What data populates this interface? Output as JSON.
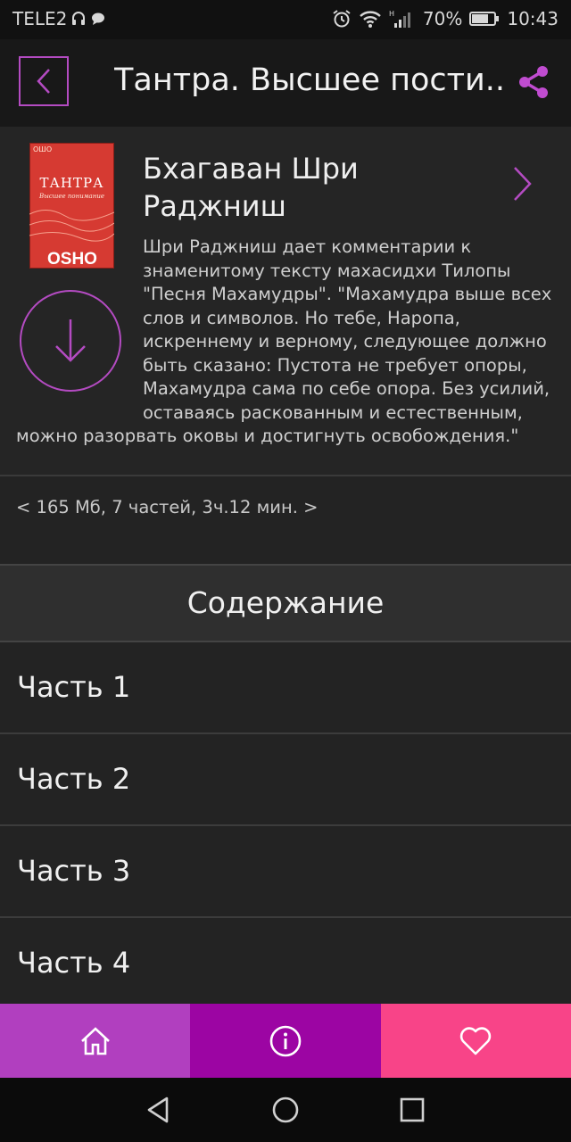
{
  "status_bar": {
    "carrier": "TELE2",
    "battery": "70%",
    "time": "10:43"
  },
  "app_bar": {
    "title": "Тантра. Высшее пости..",
    "back_icon": "chevron-left-icon",
    "share_icon": "share-icon"
  },
  "book": {
    "cover": {
      "series": "ОШО",
      "title": "ТАНТРА",
      "subtitle": "Высшее понимание",
      "author": "OSHO"
    },
    "author": "Бхагаван Шри Раджниш",
    "description": "Шри Раджниш дает комментарии к знаменитому тексту махасидхи Тилопы \"Песня Махамудры\". \"Махамудра выше всех слов и символов. Но тебе, Наропа, искреннему и верному, следующее должно быть сказано: Пустота не требует опоры, Махамудра сама по себе опора. Без усилий, оставаясь раскованным и естественным, можно разорвать оковы и достигнуть освобождения.\"",
    "meta": "< 165 Мб, 7 частей, 3ч.12 мин. >"
  },
  "contents": {
    "header": "Содержание",
    "parts": [
      "Часть 1",
      "Часть 2",
      "Часть 3",
      "Часть 4"
    ]
  },
  "tabs": [
    {
      "icon": "home-icon",
      "color": "#b13fbf"
    },
    {
      "icon": "info-icon",
      "color": "#9c05a3"
    },
    {
      "icon": "heart-icon",
      "color": "#f84488"
    }
  ],
  "accent_color": "#b44bc2"
}
